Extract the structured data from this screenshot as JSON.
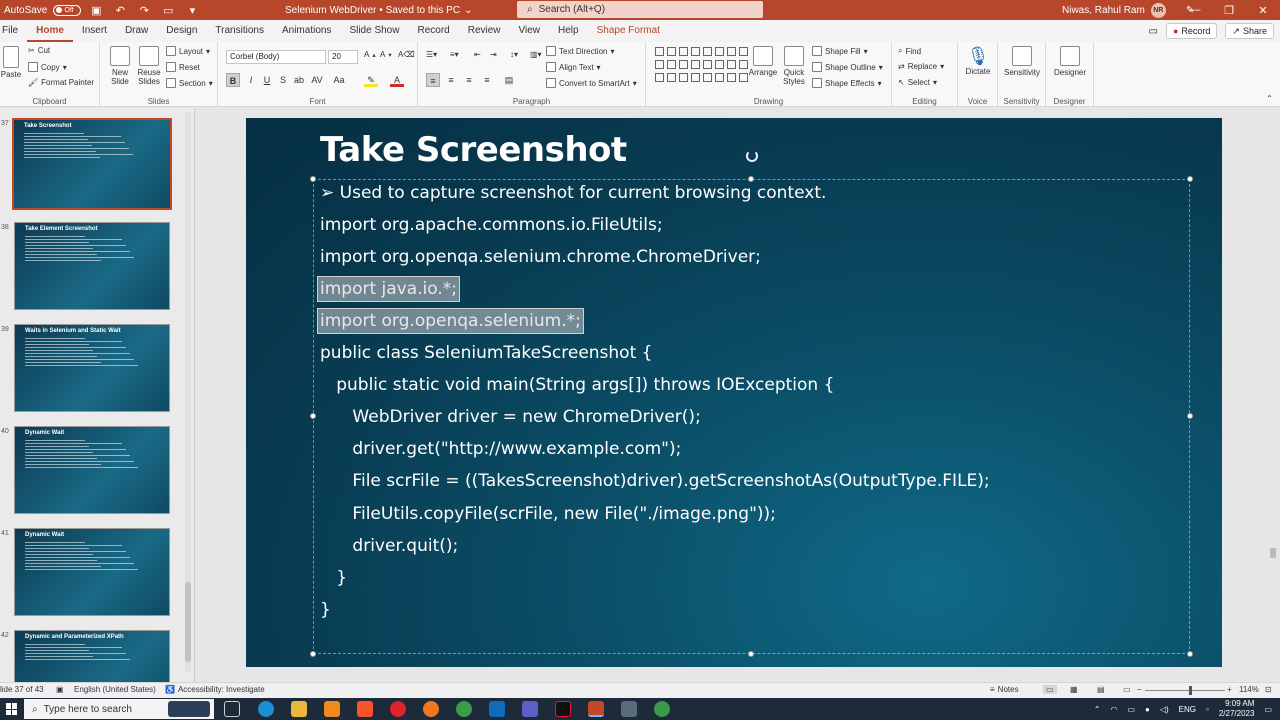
{
  "titlebar": {
    "autosave_label": "AutoSave",
    "autosave_state": "Off",
    "doc_title": "Selenium WebDriver • Saved to this PC",
    "search_placeholder": "Search (Alt+Q)",
    "user_name": "Niwas, Rahul Ram",
    "user_initials": "NR",
    "accent": "#b7472a"
  },
  "tabs": [
    "File",
    "Home",
    "Insert",
    "Draw",
    "Design",
    "Transitions",
    "Animations",
    "Slide Show",
    "Record",
    "Review",
    "View",
    "Help"
  ],
  "context_tab": "Shape Format",
  "tab_right": {
    "record": "Record",
    "share": "Share"
  },
  "ribbon": {
    "clipboard": {
      "label": "Clipboard",
      "paste": "Paste",
      "cut": "Cut",
      "copy": "Copy",
      "format_painter": "Format Painter"
    },
    "slides": {
      "label": "Slides",
      "new_slide": "New Slide",
      "reuse_slides": "Reuse Slides",
      "layout": "Layout",
      "reset": "Reset",
      "section": "Section"
    },
    "font": {
      "label": "Font",
      "font_name": "Corbel (Body)",
      "font_size": "20"
    },
    "paragraph": {
      "label": "Paragraph",
      "text_direction": "Text Direction",
      "align_text": "Align Text",
      "convert_smartart": "Convert to SmartArt"
    },
    "drawing": {
      "label": "Drawing",
      "arrange": "Arrange",
      "quick_styles": "Quick Styles",
      "shape_fill": "Shape Fill",
      "shape_outline": "Shape Outline",
      "shape_effects": "Shape Effects"
    },
    "editing": {
      "label": "Editing",
      "find": "Find",
      "replace": "Replace",
      "select": "Select"
    },
    "voice": {
      "label": "Voice",
      "dictate": "Dictate"
    },
    "sensitivity": {
      "label": "Sensitivity",
      "btn": "Sensitivity"
    },
    "designer": {
      "label": "Designer",
      "btn": "Designer"
    }
  },
  "thumbnails": [
    {
      "num": "37",
      "title": "Take Screenshot",
      "lines": 9
    },
    {
      "num": "38",
      "title": "Take Element Screenshot",
      "lines": 9
    },
    {
      "num": "39",
      "title": "Waits in Selenium and Static Wait",
      "lines": 10
    },
    {
      "num": "40",
      "title": "Dynamic Wait",
      "lines": 10
    },
    {
      "num": "41",
      "title": "Dynamic Wait",
      "lines": 10
    },
    {
      "num": "42",
      "title": "Dynamic and Parameterized XPath",
      "lines": 6
    }
  ],
  "slide": {
    "title": "Take Screenshot",
    "bullet": "Used to capture screenshot for current browsing context.",
    "lines": [
      "import org.apache.commons.io.FileUtils;",
      "import org.openqa.selenium.chrome.ChromeDriver;",
      "import java.io.*;",
      "import org.openqa.selenium.*;",
      "public class SeleniumTakeScreenshot {",
      "   public static void main(String args[]) throws IOException {",
      "      WebDriver driver = new ChromeDriver();",
      "      driver.get(\"http://www.example.com\");",
      "      File scrFile = ((TakesScreenshot)driver).getScreenshotAs(OutputType.FILE);",
      "      FileUtils.copyFile(scrFile, new File(\"./image.png\"));",
      "      driver.quit();",
      "   }",
      "}"
    ]
  },
  "status": {
    "slide_count": "lide 37 of 43",
    "language": "English (United States)",
    "accessibility": "Accessibility: Investigate",
    "notes": "Notes",
    "zoom": "114%"
  },
  "taskbar": {
    "search_placeholder": "Type here to search",
    "lang": "ENG",
    "time": "9:09 AM",
    "date": "2/27/2023"
  }
}
